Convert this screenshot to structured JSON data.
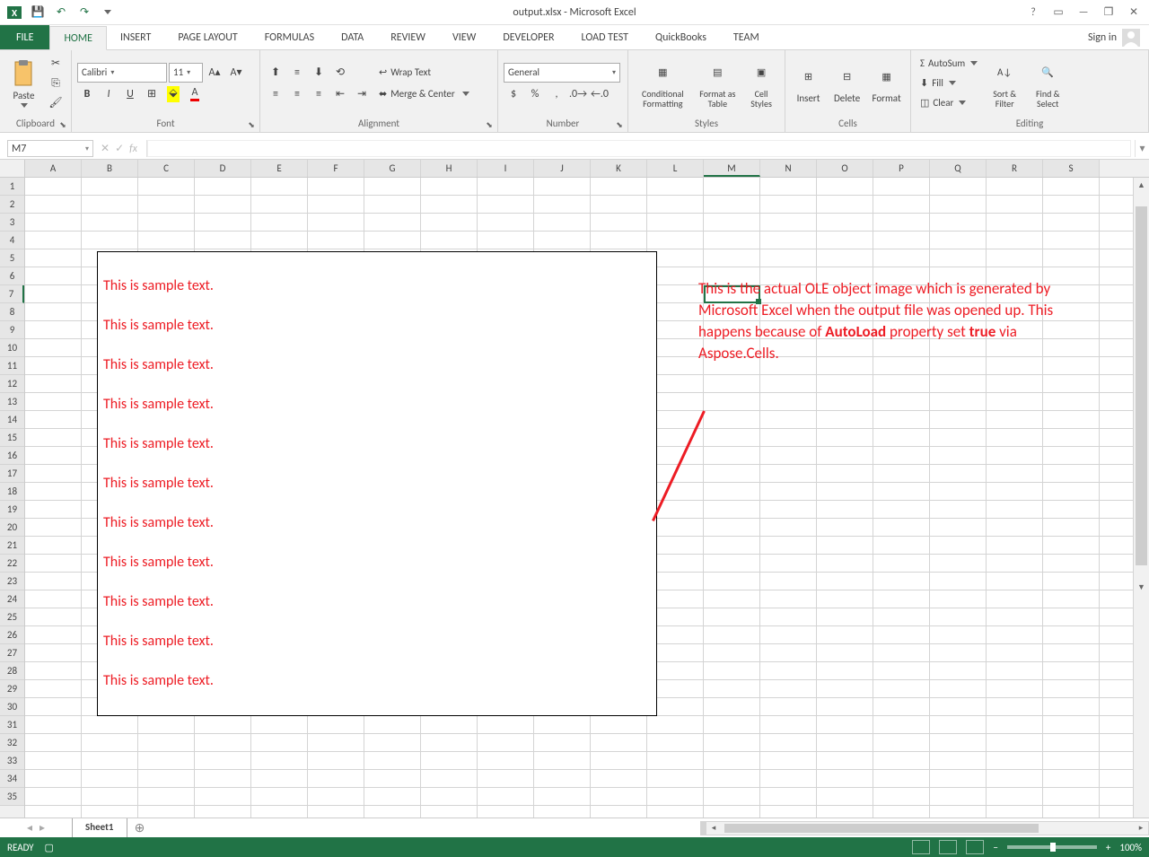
{
  "title": "output.xlsx - Microsoft Excel",
  "qa": {
    "save": "💾",
    "undo": "↶",
    "redo": "↷"
  },
  "win": {
    "help": "?",
    "ribbon": "▭",
    "min": "—",
    "restore": "❐",
    "close": "✕"
  },
  "signin": "Sign in",
  "tabs": {
    "file": "FILE",
    "home": "HOME",
    "insert": "INSERT",
    "pagelayout": "PAGE LAYOUT",
    "formulas": "FORMULAS",
    "data": "DATA",
    "review": "REVIEW",
    "view": "VIEW",
    "developer": "DEVELOPER",
    "loadtest": "LOAD TEST",
    "quickbooks": "QuickBooks",
    "team": "TEAM"
  },
  "ribbon": {
    "clipboard": {
      "label": "Clipboard",
      "paste": "Paste"
    },
    "font": {
      "label": "Font",
      "name": "Calibri",
      "size": "11",
      "bold": "B",
      "italic": "I",
      "underline": "U"
    },
    "alignment": {
      "label": "Alignment",
      "wrap": "Wrap Text",
      "merge": "Merge & Center"
    },
    "number": {
      "label": "Number",
      "format": "General",
      "currency": "$",
      "percent": "%",
      "comma": ",",
      "inc": "⁰₀",
      "dec": "₀⁰"
    },
    "styles": {
      "label": "Styles",
      "cond": "Conditional Formatting",
      "table": "Format as Table",
      "cell": "Cell Styles"
    },
    "cells": {
      "label": "Cells",
      "insert": "Insert",
      "delete": "Delete",
      "format": "Format"
    },
    "editing": {
      "label": "Editing",
      "sum": "AutoSum",
      "fill": "Fill",
      "clear": "Clear",
      "sort": "Sort & Filter",
      "find": "Find & Select"
    }
  },
  "namebox": "M7",
  "columns": [
    "A",
    "B",
    "C",
    "D",
    "E",
    "F",
    "G",
    "H",
    "I",
    "J",
    "K",
    "L",
    "M",
    "N",
    "O",
    "P",
    "Q",
    "R",
    "S"
  ],
  "row_count": 35,
  "active_cell": {
    "row": 7,
    "col": "M"
  },
  "ole": {
    "lines": [
      "This is sample text.",
      "This is sample text.",
      "This is sample text.",
      "This is sample text.",
      "This is sample text.",
      "This is sample text.",
      "This is sample text.",
      "This is sample text.",
      "This is sample text.",
      "This is sample text.",
      "This is sample text."
    ]
  },
  "annotation": {
    "p1": "This is the actual OLE object image which is generated by Microsoft Excel when the output file was opened up. This happens because of ",
    "bold1": "AutoLoad",
    "p2": " property set ",
    "bold2": "true",
    "p3": " via Aspose.Cells."
  },
  "sheet": {
    "name": "Sheet1"
  },
  "status": {
    "ready": "READY",
    "zoom": "100%"
  }
}
